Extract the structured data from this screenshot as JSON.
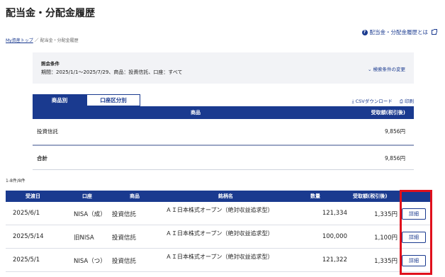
{
  "page": {
    "title": "配当金・分配金履歴",
    "help_link": "配当金・分配金履歴とは",
    "breadcrumb": {
      "home": "My資産トップ",
      "sep": "／",
      "current": "配当金・分配金履歴"
    }
  },
  "conditions": {
    "heading": "照会条件",
    "value": "期間：2025/1/1〜2025/7/29、商品：投資信託、口座：すべて",
    "change_label": "⌄ 検索条件の変更"
  },
  "tabs": [
    {
      "label": "商品別",
      "active": true
    },
    {
      "label": "口座区分別",
      "active": false
    }
  ],
  "actions": {
    "csv": "⤓ CSVダウンロード",
    "print": "⎙ 印刷"
  },
  "summary": {
    "headers": {
      "product": "商品",
      "amount": "受取額(税引後)"
    },
    "rows": [
      {
        "product": "投資信託",
        "amount": "9,856円"
      }
    ],
    "total": {
      "label": "合計",
      "amount": "9,856円"
    }
  },
  "detail": {
    "count": "1-8件/8件",
    "headers": {
      "date": "受渡日",
      "account": "口座",
      "product": "商品",
      "fund": "銘柄名",
      "qty": "数量",
      "amount": "受取額(税引後)"
    },
    "rows": [
      {
        "date": "2025/6/1",
        "account": "NISA（成）",
        "product": "投資信託",
        "fund": "ＡＩ日本株式オープン（絶対収益追求型）",
        "qty": "121,334",
        "amount": "1,335円",
        "button": "詳細"
      },
      {
        "date": "2025/5/14",
        "account": "旧NISA",
        "product": "投資信託",
        "fund": "ＡＩ日本株式オープン（絶対収益追求型）",
        "qty": "100,000",
        "amount": "1,100円",
        "button": "詳細"
      },
      {
        "date": "2025/5/1",
        "account": "NISA（つ）",
        "product": "投資信託",
        "fund": "ＡＩ日本株式オープン（絶対収益追求型）",
        "qty": "121,322",
        "amount": "1,335円",
        "button": "詳細"
      }
    ]
  },
  "colors": {
    "brand": "#1a3a8f",
    "highlight": "#e0101c"
  }
}
